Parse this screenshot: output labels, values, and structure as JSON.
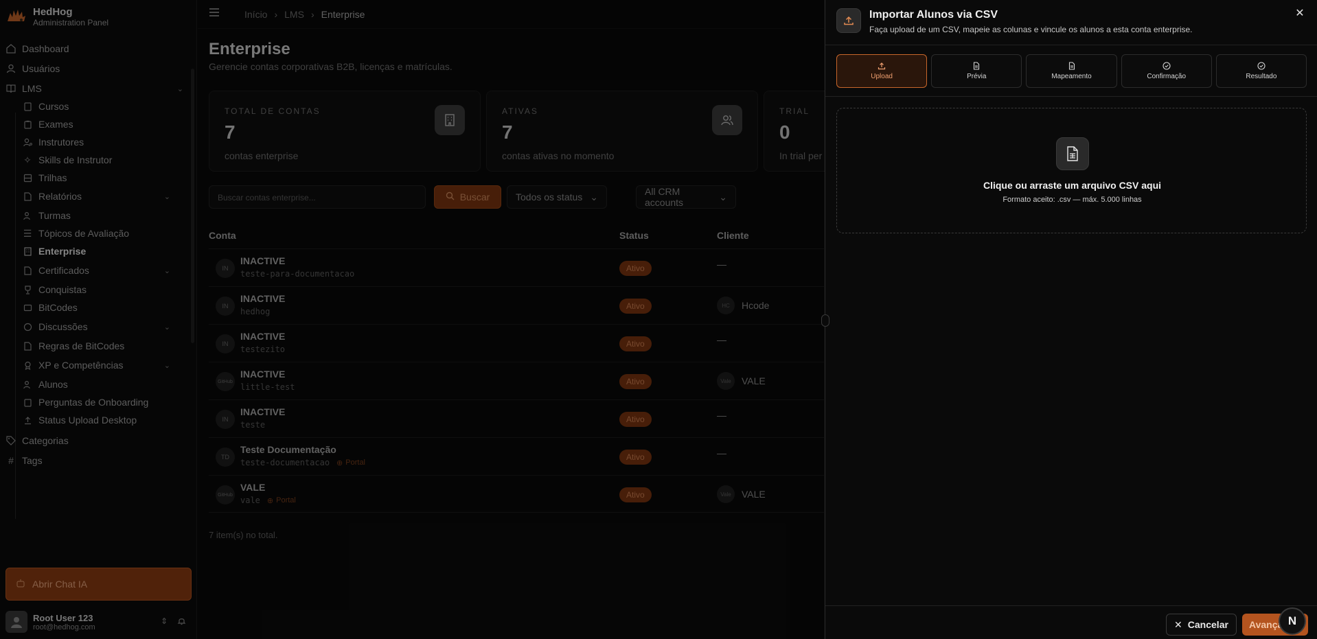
{
  "brand": {
    "name": "HedHog",
    "subtitle": "Administration Panel"
  },
  "nav": {
    "dashboard": "Dashboard",
    "usuarios": "Usuários",
    "lms": "LMS",
    "cursos": "Cursos",
    "exames": "Exames",
    "instrutores": "Instrutores",
    "skills": "Skills de Instrutor",
    "trilhas": "Trilhas",
    "relatorios": "Relatórios",
    "turmas": "Turmas",
    "topicos": "Tópicos de Avaliação",
    "enterprise": "Enterprise",
    "certificados": "Certificados",
    "conquistas": "Conquistas",
    "bitcodes": "BitCodes",
    "discussoes": "Discussões",
    "regras": "Regras de BitCodes",
    "xp": "XP e Competências",
    "alunos": "Alunos",
    "perguntas": "Perguntas de Onboarding",
    "status_upload": "Status Upload Desktop",
    "categorias": "Categorias",
    "tags": "Tags"
  },
  "chat_button": "Abrir Chat IA",
  "user": {
    "name": "Root User 123",
    "email": "root@hedhog.com"
  },
  "breadcrumb": {
    "home": "Início",
    "lms": "LMS",
    "current": "Enterprise"
  },
  "page": {
    "title": "Enterprise",
    "description": "Gerencie contas corporativas B2B, licenças e matrículas."
  },
  "stats": [
    {
      "label": "TOTAL DE CONTAS",
      "value": "7",
      "sub": "contas enterprise"
    },
    {
      "label": "ATIVAS",
      "value": "7",
      "sub": "contas ativas no momento"
    },
    {
      "label": "TRIAL",
      "value": "0",
      "sub": "In trial per"
    }
  ],
  "filters": {
    "search_placeholder": "Buscar contas enterprise...",
    "search_button": "Buscar",
    "status_select": "Todos os status",
    "crm_select": "All CRM accounts"
  },
  "table": {
    "headers": {
      "conta": "Conta",
      "status": "Status",
      "cliente": "Cliente"
    },
    "rows": [
      {
        "avatar": "IN",
        "name": "INACTIVE",
        "slug": "teste-para-documentacao",
        "portal": "",
        "status": "Ativo",
        "client": "—",
        "client_av": ""
      },
      {
        "avatar": "IN",
        "name": "INACTIVE",
        "slug": "hedhog",
        "portal": "",
        "status": "Ativo",
        "client": "Hcode",
        "client_av": "HC"
      },
      {
        "avatar": "IN",
        "name": "INACTIVE",
        "slug": "testezito",
        "portal": "",
        "status": "Ativo",
        "client": "—",
        "client_av": ""
      },
      {
        "avatar": "GitHub",
        "name": "INACTIVE",
        "slug": "little-test",
        "portal": "",
        "status": "Ativo",
        "client": "VALE",
        "client_av": "Vale"
      },
      {
        "avatar": "IN",
        "name": "INACTIVE",
        "slug": "teste",
        "portal": "",
        "status": "Ativo",
        "client": "—",
        "client_av": ""
      },
      {
        "avatar": "TD",
        "name": "Teste Documentação",
        "slug": "teste-documentacao",
        "portal": "Portal",
        "status": "Ativo",
        "client": "—",
        "client_av": ""
      },
      {
        "avatar": "GitHub",
        "name": "VALE",
        "slug": "vale",
        "portal": "Portal",
        "status": "Ativo",
        "client": "VALE",
        "client_av": "Vale"
      }
    ],
    "total": "7 item(s) no total."
  },
  "drawer": {
    "title": "Importar Alunos via CSV",
    "subtitle": "Faça upload de um CSV, mapeie as colunas e vincule os alunos a esta conta enterprise.",
    "steps": [
      "Upload",
      "Prévia",
      "Mapeamento",
      "Confirmação",
      "Resultado"
    ],
    "active_step": 0,
    "dropzone": {
      "title": "Clique ou arraste um arquivo CSV aqui",
      "subtitle": "Formato aceito: .csv — máx. 5.000 linhas"
    },
    "cancel": "Cancelar",
    "next": "Avançar"
  },
  "colors": {
    "accent": "#b4541f",
    "accent_dark": "#7a3510",
    "background": "#0a0a0a"
  },
  "floating_badge": "N"
}
